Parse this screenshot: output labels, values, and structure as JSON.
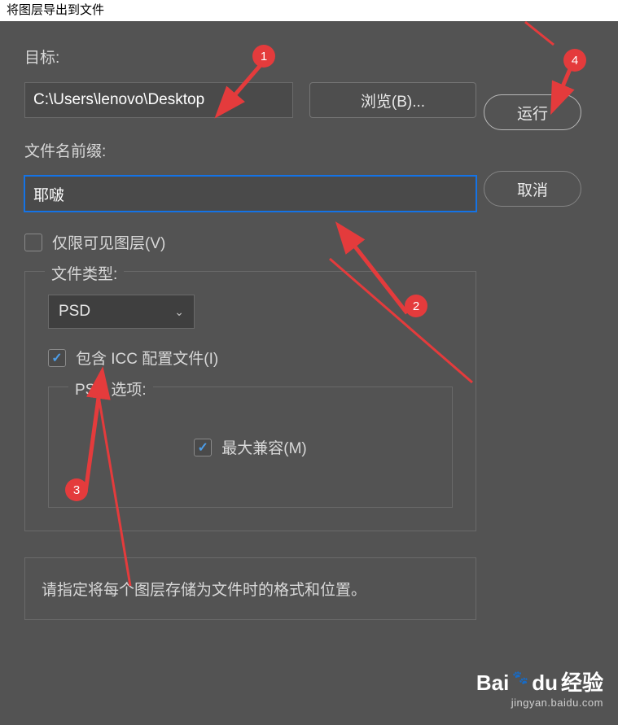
{
  "title": "将图层导出到文件",
  "labels": {
    "target": "目标:",
    "prefix": "文件名前缀:",
    "visible_only": "仅限可见图层(V)",
    "file_type": "文件类型:",
    "include_icc": "包含 ICC 配置文件(I)",
    "psd_options": "PSD 选项:",
    "max_compat": "最大兼容(M)"
  },
  "inputs": {
    "target_path": "C:\\Users\\lenovo\\Desktop",
    "prefix_value": "耶啵"
  },
  "dropdown": {
    "file_type_value": "PSD"
  },
  "buttons": {
    "browse": "浏览(B)...",
    "run": "运行",
    "cancel": "取消"
  },
  "footer": "请指定将每个图层存储为文件时的格式和位置。",
  "markers": {
    "m1": "1",
    "m2": "2",
    "m3": "3",
    "m4": "4"
  },
  "watermark": {
    "brand": "Bai",
    "brand2": "du",
    "cn": "经验",
    "url": "jingyan.baidu.com"
  }
}
